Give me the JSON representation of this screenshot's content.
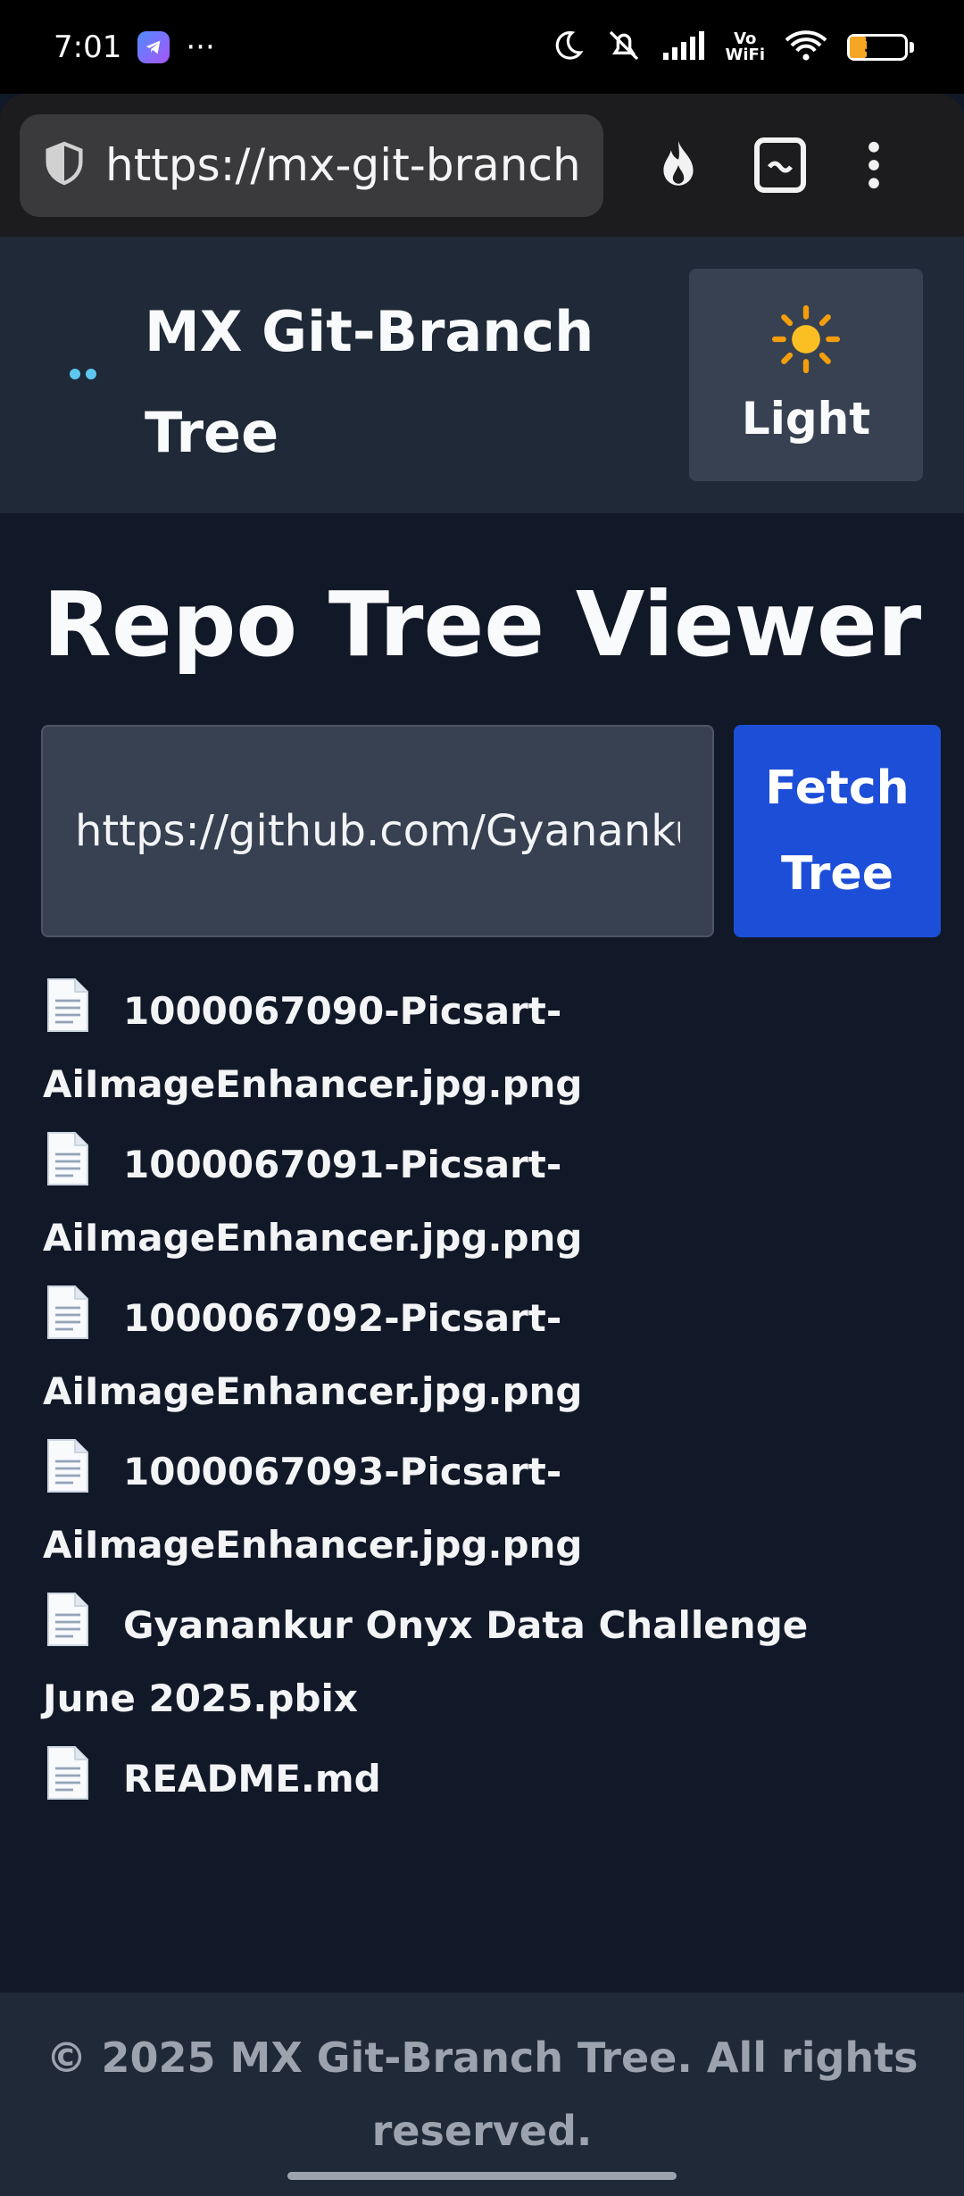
{
  "status_bar": {
    "time": "7:01",
    "more": "···",
    "wifi_label": "Vo\nWiFi",
    "battery": "31"
  },
  "browser": {
    "url": "https://mx-git-branch-tree"
  },
  "header": {
    "title": "MX Git-Branch Tree",
    "theme_toggle": {
      "icon": "☀️",
      "label": "Light"
    }
  },
  "main": {
    "title": "Repo Tree Viewer",
    "repo_input_value": "https://github.com/Gyanankur",
    "fetch_label": "Fetch Tree",
    "files": [
      "1000067090-Picsart-AiImageEnhancer.jpg.png",
      "1000067091-Picsart-AiImageEnhancer.jpg.png",
      "1000067092-Picsart-AiImageEnhancer.jpg.png",
      "1000067093-Picsart-AiImageEnhancer.jpg.png",
      "Gyanankur Onyx Data Challenge June 2025.pbix",
      "README.md"
    ]
  },
  "footer": {
    "text": "© 2025 MX Git-Branch Tree. All rights reserved."
  },
  "colors": {
    "page_bg": "#111827",
    "header_bg": "#1f2937",
    "input_bg": "#374151",
    "accent": "#1d4ed8",
    "logo": "#5ec8f0"
  }
}
